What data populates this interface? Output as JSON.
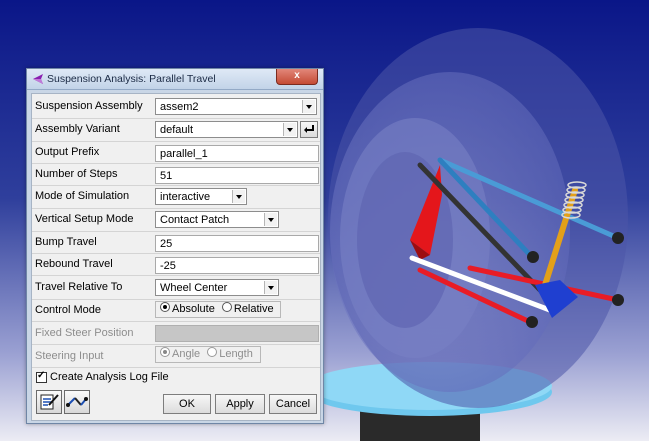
{
  "dialog": {
    "title": "Suspension Analysis: Parallel Travel",
    "close_label": "x"
  },
  "form": {
    "suspension_assembly": {
      "label": "Suspension Assembly",
      "value": "assem2"
    },
    "assembly_variant": {
      "label": "Assembly Variant",
      "value": "default"
    },
    "output_prefix": {
      "label": "Output Prefix",
      "value": "parallel_1"
    },
    "number_of_steps": {
      "label": "Number of Steps",
      "value": "51"
    },
    "mode_of_simulation": {
      "label": "Mode of Simulation",
      "value": "interactive"
    },
    "vertical_setup_mode": {
      "label": "Vertical Setup Mode",
      "value": "Contact Patch"
    },
    "bump_travel": {
      "label": "Bump Travel",
      "value": "25"
    },
    "rebound_travel": {
      "label": "Rebound Travel",
      "value": "-25"
    },
    "travel_relative_to": {
      "label": "Travel Relative To",
      "value": "Wheel Center"
    },
    "control_mode": {
      "label": "Control Mode",
      "option1": "Absolute",
      "option2": "Relative"
    },
    "fixed_steer_position": {
      "label": "Fixed Steer Position",
      "value": ""
    },
    "steering_input": {
      "label": "Steering Input",
      "option1": "Angle",
      "option2": "Length"
    },
    "create_log": {
      "label": "Create Analysis Log File",
      "checked": true
    }
  },
  "buttons": {
    "ok": "OK",
    "apply": "Apply",
    "cancel": "Cancel"
  },
  "icons": {
    "title": "adams-car-icon",
    "variant_enter": "enter-arrow-icon",
    "tool1": "edit-form-icon",
    "tool2": "suspension-analysis-icon"
  },
  "colors": {
    "viewport_top": "#0c1a8a",
    "viewport_bottom": "#e6e6f2",
    "dialog_frame": "#c9d6e6",
    "close_button": "#c94c36"
  }
}
